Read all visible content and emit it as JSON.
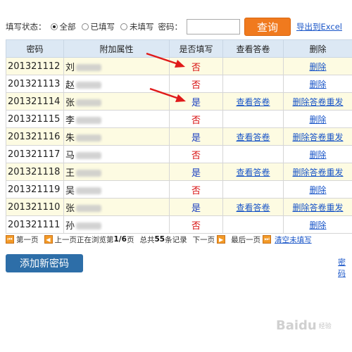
{
  "filter": {
    "status_label": "填写状态：",
    "options": [
      "全部",
      "已填写",
      "未填写"
    ],
    "selected": "全部",
    "password_label": "密码：",
    "password_value": "",
    "query_label": "查询",
    "export_label": "导出到Excel"
  },
  "table": {
    "headers": [
      "密码",
      "附加属性",
      "是否填写",
      "查看答卷",
      "删除"
    ],
    "rows": [
      {
        "code": "201321112",
        "name": "刘",
        "filled": "否",
        "view": "",
        "del": "删除"
      },
      {
        "code": "201321113",
        "name": "赵",
        "filled": "否",
        "view": "",
        "del": "删除"
      },
      {
        "code": "201321114",
        "name": "张",
        "filled": "是",
        "view": "查看答卷",
        "del": "删除答卷重发"
      },
      {
        "code": "201321115",
        "name": "李",
        "filled": "否",
        "view": "",
        "del": "删除"
      },
      {
        "code": "201321116",
        "name": "朱",
        "filled": "是",
        "view": "查看答卷",
        "del": "删除答卷重发"
      },
      {
        "code": "201321117",
        "name": "马",
        "filled": "否",
        "view": "",
        "del": "删除"
      },
      {
        "code": "201321118",
        "name": "王",
        "filled": "是",
        "view": "查看答卷",
        "del": "删除答卷重发"
      },
      {
        "code": "201321119",
        "name": "吴",
        "filled": "否",
        "view": "",
        "del": "删除"
      },
      {
        "code": "201321110",
        "name": "张",
        "filled": "是",
        "view": "查看答卷",
        "del": "删除答卷重发"
      },
      {
        "code": "201321111",
        "name": "孙",
        "filled": "否",
        "view": "",
        "del": "删除"
      }
    ]
  },
  "pager": {
    "first": "第一页",
    "prev": "上一页",
    "browsing": "正在浏览第",
    "page": "1/6",
    "page_suffix": "页",
    "total_prefix": "总共",
    "total": "55",
    "total_suffix": "条记录",
    "next": "下一页",
    "last": "最后一页",
    "clear": "清空未填写"
  },
  "actions": {
    "add_label": "添加新密码",
    "right_link": "密码"
  },
  "watermark": {
    "brand": "Baidu",
    "sub": "经验"
  },
  "colors": {
    "accent_orange": "#f07a1e",
    "primary_blue": "#2d6ea8",
    "no_red": "#d81010",
    "yes_blue": "#1a3fc0",
    "arrow_red": "#e01a1a",
    "header_bg": "#dce8f4",
    "row_alt_bg": "#fdfbe2"
  }
}
